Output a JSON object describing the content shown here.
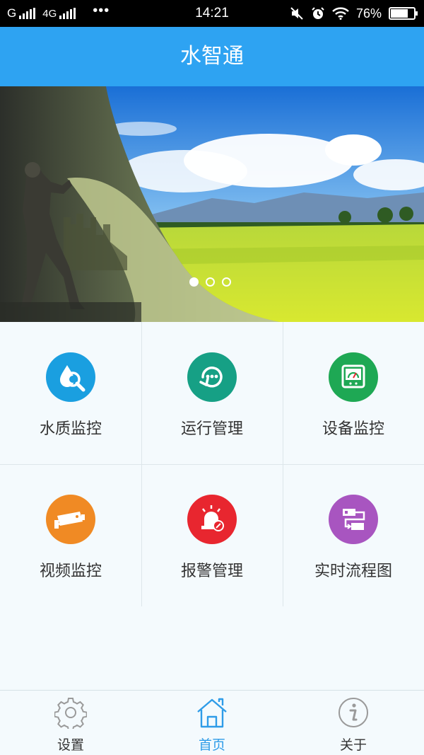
{
  "status_bar": {
    "carrier": "G",
    "network": "4G",
    "dots": "•••",
    "time": "14:21",
    "battery_text": "76%",
    "battery_level": 0.76
  },
  "app": {
    "title": "水智通"
  },
  "banner": {
    "slide_count": 3,
    "active_slide": 0
  },
  "grid": {
    "items": [
      {
        "label": "水质监控",
        "icon": "water-quality-search-icon",
        "color": "#1a9fe0"
      },
      {
        "label": "运行管理",
        "icon": "refresh-chat-icon",
        "color": "#16a085"
      },
      {
        "label": "设备监控",
        "icon": "gauge-device-icon",
        "color": "#1ea854"
      },
      {
        "label": "视频监控",
        "icon": "camera-icon",
        "color": "#f08a24"
      },
      {
        "label": "报警管理",
        "icon": "alarm-siren-icon",
        "color": "#e8262f"
      },
      {
        "label": "实时流程图",
        "icon": "flow-chart-icon",
        "color": "#a855c0"
      }
    ]
  },
  "bottom_nav": {
    "items": [
      {
        "label": "设置",
        "icon": "gear-icon",
        "active": false
      },
      {
        "label": "首页",
        "icon": "home-icon",
        "active": true
      },
      {
        "label": "关于",
        "icon": "info-icon",
        "active": false
      }
    ],
    "active_color": "#2e9ce8",
    "inactive_color": "#9a9a9a"
  }
}
